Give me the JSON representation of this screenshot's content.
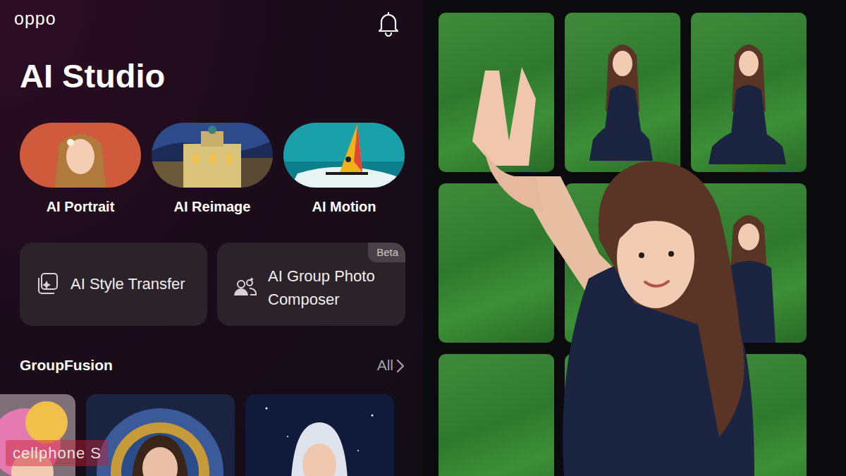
{
  "brand": "oppo",
  "title": "AI Studio",
  "features": [
    {
      "label": "AI Portrait"
    },
    {
      "label": "AI Reimage"
    },
    {
      "label": "AI Motion"
    }
  ],
  "tools": [
    {
      "label": "AI Style Transfer"
    },
    {
      "label": "AI Group Photo Composer",
      "badge": "Beta"
    }
  ],
  "section": {
    "title": "GroupFusion",
    "link": "All"
  },
  "watermark": "cellphone S"
}
